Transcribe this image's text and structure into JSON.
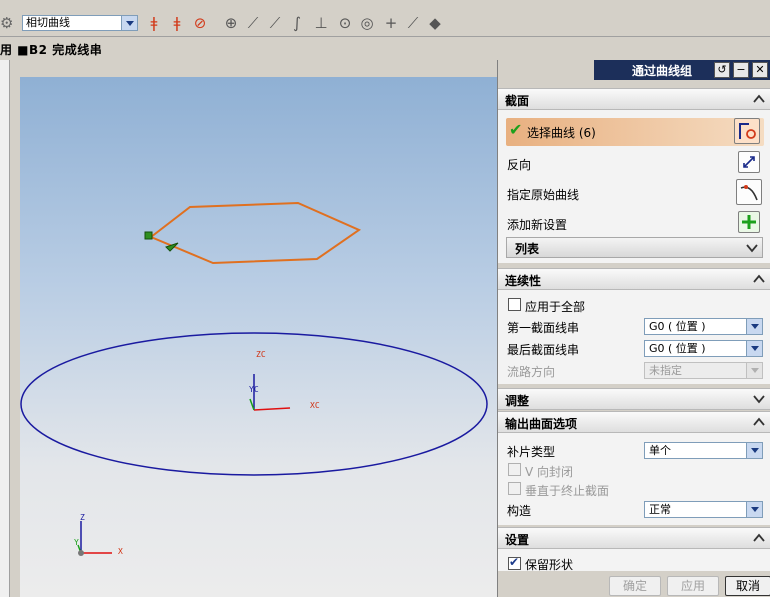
{
  "toolbar": {
    "curve_rule_combo": "相切曲线",
    "colors": {
      "accent": "#1c2f5a",
      "icon_red": "#d23a1a"
    }
  },
  "statusbar": {
    "text": "用 ■B2 完成线串"
  },
  "viewport": {
    "labels": {
      "zc": "ZC",
      "yc": "YC",
      "xc": "XC",
      "z": "Z",
      "y": "Y",
      "x": "X"
    },
    "colors": {
      "section_curve": "#e07020",
      "guide_curve": "#1a1aa0"
    }
  },
  "dialog": {
    "title": "通过曲线组",
    "sections": {
      "section": {
        "title": "截面",
        "select_curve": "选择曲线 (6)",
        "reverse": "反向",
        "specify_origin": "指定原始曲线",
        "add_new_set": "添加新设置",
        "list": "列表"
      },
      "continuity": {
        "title": "连续性",
        "apply_all": "应用于全部",
        "first_label": "第一截面线串",
        "first_value": "G0 ( 位置 )",
        "last_label": "最后截面线串",
        "last_value": "G0 ( 位置 )",
        "flow_label": "流路方向",
        "flow_value": "未指定"
      },
      "adjust": {
        "title": "调整"
      },
      "output": {
        "title": "输出曲面选项",
        "patch_label": "补片类型",
        "patch_value": "单个",
        "v_closed": "V 向封闭",
        "normal_to_end": "垂直于终止截面",
        "construct_label": "构造",
        "construct_value": "正常"
      },
      "settings": {
        "title": "设置",
        "keep_shape": "保留形状"
      }
    },
    "buttons": {
      "ok": "确定",
      "apply": "应用",
      "cancel": "取消"
    }
  }
}
